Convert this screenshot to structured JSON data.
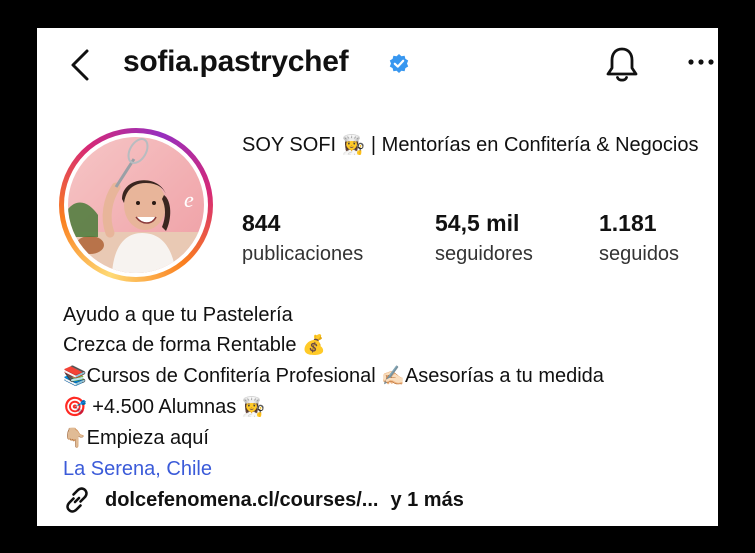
{
  "header": {
    "username": "sofia.pastrychef",
    "icons": [
      "back-chevron-icon",
      "verified-badge-icon",
      "bell-icon",
      "more-options-icon"
    ]
  },
  "profile": {
    "display_name": "SOY SOFI",
    "display_name_emoji": "👩‍🍳",
    "display_name_rest": " | Mentorías en Confitería & Negocios",
    "stats": [
      {
        "value": "844",
        "label": "publicaciones"
      },
      {
        "value": "54,5 mil",
        "label": "seguidores"
      },
      {
        "value": "1.181",
        "label": "seguidos"
      }
    ]
  },
  "bio": {
    "line1": "Ayudo a que tu Pastelería",
    "line2_text": "Crezca de forma Rentable ",
    "line2_emoji": "💰",
    "line3_emoji1": "📚",
    "line3_text1": "Cursos de Confitería Profesional ",
    "line3_emoji2": "✍🏻",
    "line3_text2": "Asesorías a tu medida",
    "line4_emoji1": "🎯",
    "line4_text": " +4.500 Alumnas ",
    "line4_emoji2": "👩‍🍳",
    "line5_emoji": "👇🏼",
    "line5_text": "Empieza aquí",
    "location": "La Serena, Chile",
    "link": "dolcefenomena.cl/courses/...",
    "link_more": "y 1 más"
  },
  "colors": {
    "background": "#000000",
    "card": "#ffffff",
    "verified_blue": "#3897f0",
    "location_link": "#3b5bd9"
  }
}
